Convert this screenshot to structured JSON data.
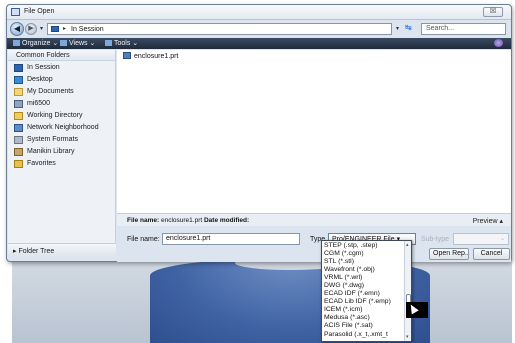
{
  "window": {
    "title": "File Open",
    "close_label": "☒"
  },
  "address_bar": {
    "path": "In Session",
    "search_placeholder": "Search..."
  },
  "toolbar": {
    "organize": "Organize ⌄",
    "views": "Views ⌄",
    "tools": "Tools ⌄"
  },
  "sidebar": {
    "header": "Common Folders",
    "items": [
      {
        "label": "In Session",
        "icon": "session-icon"
      },
      {
        "label": "Desktop",
        "icon": "desktop-icon"
      },
      {
        "label": "My Documents",
        "icon": "documents-icon"
      },
      {
        "label": "mi6500",
        "icon": "computer-icon"
      },
      {
        "label": "Working Directory",
        "icon": "working-directory-icon"
      },
      {
        "label": "Network Neighborhood",
        "icon": "network-icon"
      },
      {
        "label": "System Formats",
        "icon": "system-formats-icon"
      },
      {
        "label": "Manikin Library",
        "icon": "manikin-icon"
      },
      {
        "label": "Favorites",
        "icon": "favorites-icon"
      }
    ],
    "folder_tree": "▸ Folder Tree"
  },
  "files": [
    {
      "name": "enclosure1.prt"
    }
  ],
  "details": {
    "name_label": "File name:",
    "name_value": "enclosure1.prt",
    "modified_label": "Date modified:",
    "preview": "Preview ▴"
  },
  "bottom": {
    "file_name_label": "File name:",
    "file_name_value": "enclosure1.prt",
    "type_label": "Type",
    "type_value": "Pro/ENGINEER File ▾",
    "subtype_label": "Sub-type",
    "subtype_arrow": "⌄",
    "open_label": "Open Rep...",
    "cancel_label": "Cancel"
  },
  "type_options": [
    "STEP (.stp, .step)",
    "CGM (*.cgm)",
    "STL (*.stl)",
    "Wavefront (*.obj)",
    "VRML (*.wrl)",
    "DWG (*.dwg)",
    "ECAD IDF (*.emn)",
    "ECAD Lib IDF (*.emp)",
    "ICEM (*.icm)",
    "Medusa (*.asc)",
    "ACIS File (*.sat)",
    "Parasolid (.x_t,.xmt_t"
  ]
}
